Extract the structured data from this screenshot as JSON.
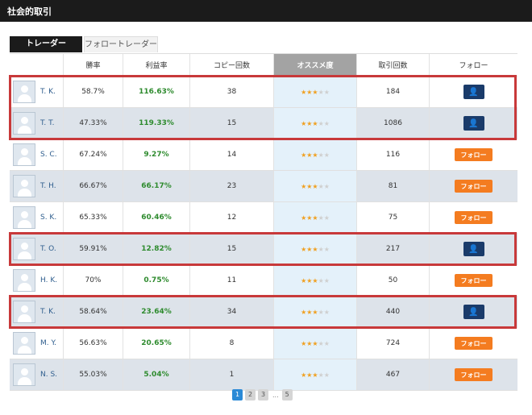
{
  "title": "社会的取引",
  "tabs": [
    {
      "label": "トレーダー",
      "active": true
    },
    {
      "label": "フォロートレーダー",
      "active": false
    }
  ],
  "columns": [
    "",
    "勝率",
    "利益率",
    "コピー回数",
    "オススメ度",
    "取引回数",
    "フォロー"
  ],
  "follow_label": "フォロー",
  "following_icon": "user-icon",
  "rating_stars": {
    "filled": 3,
    "total": 5
  },
  "accent_colors": {
    "follow": "#f47c20",
    "following": "#1a3b6a",
    "profit": "#2e8b2e",
    "highlight": "#c8393a",
    "page_active": "#2b8ad6"
  },
  "rows": [
    {
      "name": "T. K.",
      "win_rate": "58.7%",
      "profit": "116.63%",
      "copies": "38",
      "trades": "184",
      "following": true,
      "shaded": false
    },
    {
      "name": "T. T.",
      "win_rate": "47.33%",
      "profit": "119.33%",
      "copies": "15",
      "trades": "1086",
      "following": true,
      "shaded": true
    },
    {
      "name": "S. C.",
      "win_rate": "67.24%",
      "profit": "9.27%",
      "copies": "14",
      "trades": "116",
      "following": false,
      "shaded": false
    },
    {
      "name": "T. H.",
      "win_rate": "66.67%",
      "profit": "66.17%",
      "copies": "23",
      "trades": "81",
      "following": false,
      "shaded": true
    },
    {
      "name": "S. K.",
      "win_rate": "65.33%",
      "profit": "60.46%",
      "copies": "12",
      "trades": "75",
      "following": false,
      "shaded": false
    },
    {
      "name": "T. O.",
      "win_rate": "59.91%",
      "profit": "12.82%",
      "copies": "15",
      "trades": "217",
      "following": true,
      "shaded": true
    },
    {
      "name": "H. K.",
      "win_rate": "70%",
      "profit": "0.75%",
      "copies": "11",
      "trades": "50",
      "following": false,
      "shaded": false
    },
    {
      "name": "T. K.",
      "win_rate": "58.64%",
      "profit": "23.64%",
      "copies": "34",
      "trades": "440",
      "following": true,
      "shaded": true
    },
    {
      "name": "M. Y.",
      "win_rate": "56.63%",
      "profit": "20.65%",
      "copies": "8",
      "trades": "724",
      "following": false,
      "shaded": false
    },
    {
      "name": "N. S.",
      "win_rate": "55.03%",
      "profit": "5.04%",
      "copies": "1",
      "trades": "467",
      "following": false,
      "shaded": true
    }
  ],
  "pagination": {
    "pages": [
      "1",
      "2",
      "3"
    ],
    "ellipsis": "...",
    "last": "5",
    "current": "1"
  }
}
